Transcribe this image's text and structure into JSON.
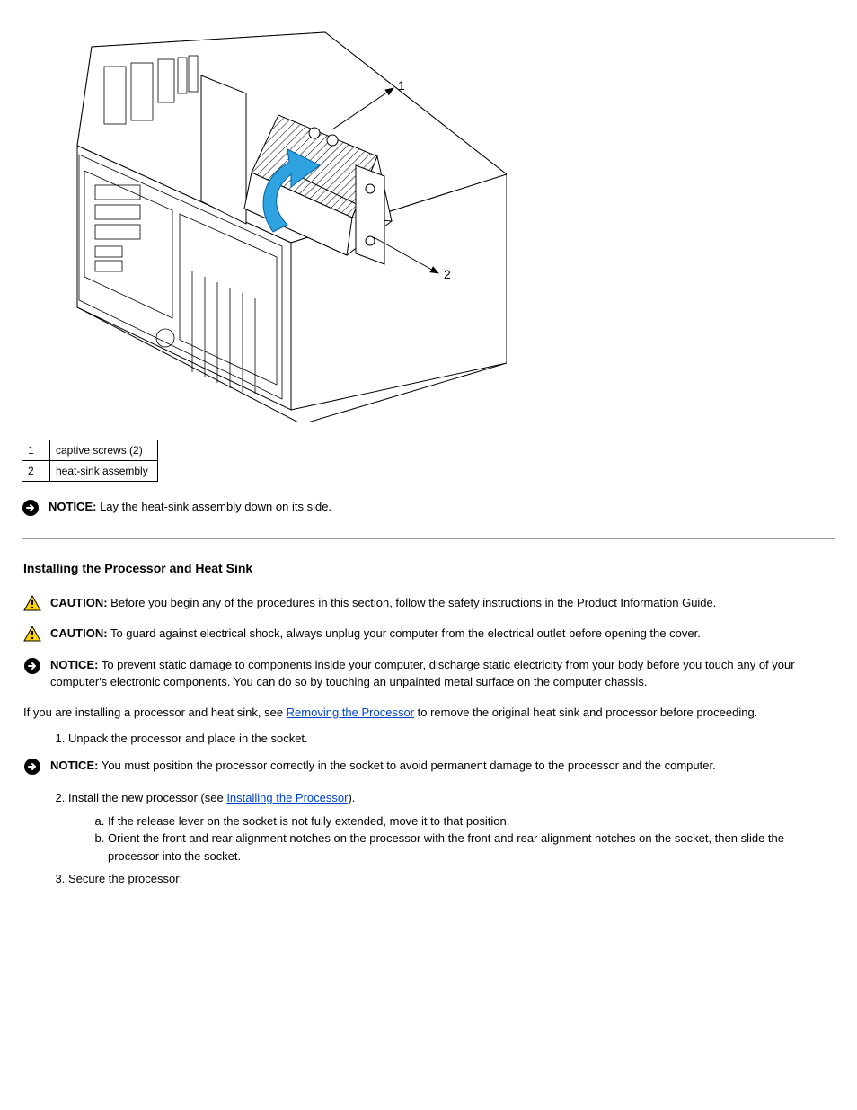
{
  "figure": {
    "callouts": [
      {
        "num": "1",
        "label": "captive screws (2)"
      },
      {
        "num": "2",
        "label": "heat-sink assembly"
      }
    ]
  },
  "notice_top": {
    "lead": "NOTICE:",
    "text": "Lay the heat-sink assembly down on its side."
  },
  "section": {
    "title": "Installing the Processor and Heat Sink",
    "caution1": {
      "lead": "CAUTION:",
      "text": "Before you begin any of the procedures in this section, follow the safety instructions in the Product Information Guide."
    },
    "caution2": {
      "lead": "CAUTION:",
      "text": "To guard against electrical shock, always unplug your computer from the electrical outlet before opening the cover."
    },
    "notice1": {
      "lead": "NOTICE:",
      "text": "To prevent static damage to components inside your computer, discharge static electricity from your body before you touch any of your computer's electronic components. You can do so by touching an unpainted metal surface on the computer chassis."
    },
    "body_para_pre": "If you are installing a processor and heat sink, see ",
    "body_link": "Removing the Processor",
    "body_para_post": " to remove the original heat sink and processor before proceeding.",
    "steps": {
      "s1": "Unpack the processor and place in the socket.",
      "notice2": {
        "lead": "NOTICE:",
        "text": "You must position the processor correctly in the socket to avoid permanent damage to the processor and the computer."
      },
      "s2_pre": "Install the new processor (see ",
      "s2_link": "Installing the Processor",
      "s2_post": ").",
      "sub_a": "If the release lever on the socket is not fully extended, move it to that position.",
      "sub_b": "Orient the front and rear alignment notches on the processor with the front and rear alignment notches on the socket, then slide the processor into the socket.",
      "s3": "Secure the processor:"
    }
  }
}
